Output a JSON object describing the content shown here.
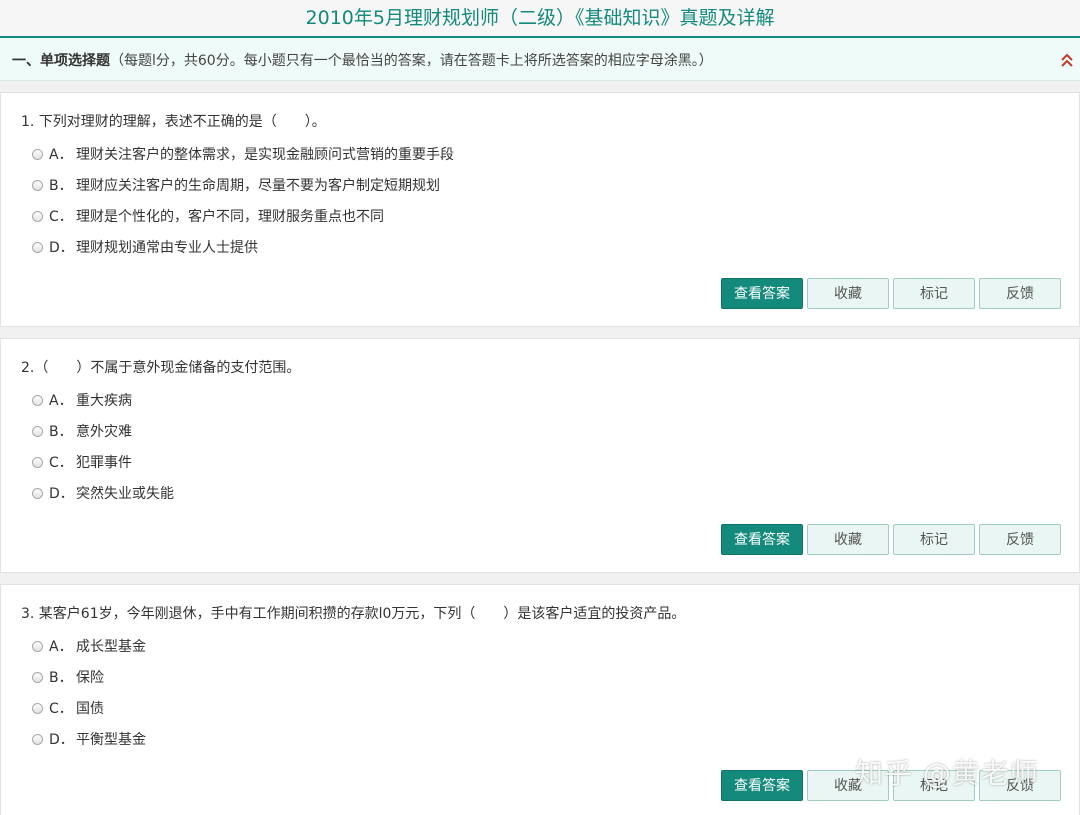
{
  "page": {
    "title": "2010年5月理财规划师（二级）《基础知识》真题及详解"
  },
  "section": {
    "heading": "一、单项选择题",
    "instructions": "（每题l分，共60分。每小题只有一个最恰当的答案，请在答题卡上将所选答案的相应字母涂黑。）",
    "collapse_icon": "double-chevron-up-icon"
  },
  "questions": [
    {
      "text": "1. 下列对理财的理解，表述不正确的是（　　）。",
      "options": [
        {
          "letter": "A．",
          "text": "理财关注客户的整体需求，是实现金融顾问式营销的重要手段"
        },
        {
          "letter": "B．",
          "text": "理财应关注客户的生命周期，尽量不要为客户制定短期规划"
        },
        {
          "letter": "C．",
          "text": "理财是个性化的，客户不同，理财服务重点也不同"
        },
        {
          "letter": "D．",
          "text": "理财规划通常由专业人士提供"
        }
      ]
    },
    {
      "text": "2.（　　）不属于意外现金储备的支付范围。",
      "options": [
        {
          "letter": "A．",
          "text": "重大疾病"
        },
        {
          "letter": "B．",
          "text": "意外灾难"
        },
        {
          "letter": "C．",
          "text": "犯罪事件"
        },
        {
          "letter": "D．",
          "text": "突然失业或失能"
        }
      ]
    },
    {
      "text": "3. 某客户61岁，今年刚退休，手中有工作期间积攒的存款l0万元，下列（　　）是该客户适宜的投资产品。",
      "options": [
        {
          "letter": "A．",
          "text": "成长型基金"
        },
        {
          "letter": "B．",
          "text": "保险"
        },
        {
          "letter": "C．",
          "text": "国债"
        },
        {
          "letter": "D．",
          "text": "平衡型基金"
        }
      ]
    }
  ],
  "buttons": {
    "view_answer": "查看答案",
    "favorite": "收藏",
    "mark": "标记",
    "feedback": "反馈"
  },
  "watermark": "知乎 @黄老师",
  "colors": {
    "accent": "#138a7c",
    "section_bg": "#eefbf8",
    "button_bg": "#eaf6f3"
  }
}
